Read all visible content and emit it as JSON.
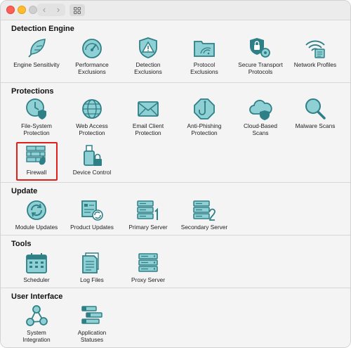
{
  "colors": {
    "icon_stroke": "#2f7f87",
    "icon_fill": "#8fd0d4",
    "highlight": "#e0201b"
  },
  "titlebar": {
    "nav_back_glyph": "‹",
    "nav_forward_glyph": "›"
  },
  "sections": {
    "detection": {
      "title": "Detection Engine",
      "items": [
        "Engine Sensitivity",
        "Performance\nExclusions",
        "Detection\nExclusions",
        "Protocol\nExclusions",
        "Secure Transport\nProtocols",
        "Network Profiles"
      ]
    },
    "protections": {
      "title": "Protections",
      "items": [
        "File-System\nProtection",
        "Web Access\nProtection",
        "Email Client\nProtection",
        "Anti-Phishing\nProtection",
        "Cloud-Based\nScans",
        "Malware Scans",
        "Firewall",
        "Device Control"
      ]
    },
    "update": {
      "title": "Update",
      "items": [
        "Module Updates",
        "Product Updates",
        "Primary Server",
        "Secondary Server"
      ]
    },
    "tools": {
      "title": "Tools",
      "items": [
        "Scheduler",
        "Log Files",
        "Proxy Server"
      ]
    },
    "ui": {
      "title": "User Interface",
      "items": [
        "System\nIntegration",
        "Application\nStatuses"
      ]
    }
  },
  "icons": {
    "detection": [
      "feather-icon",
      "gauge-icon",
      "warning-shield-icon",
      "folder-network-icon",
      "lock-shield-gear-icon",
      "wifi-list-icon"
    ],
    "protections": [
      "clock-shield-icon",
      "globe-icon",
      "envelope-icon",
      "fishhook-icon",
      "cloud-shield-icon",
      "magnifier-icon",
      "firewall-icon",
      "usb-lock-icon"
    ],
    "update": [
      "sync-icon",
      "product-update-icon",
      "server-1-icon",
      "server-2-icon"
    ],
    "tools": [
      "calendar-icon",
      "log-files-icon",
      "proxy-server-icon"
    ],
    "ui": [
      "network-nodes-icon",
      "status-bars-icon"
    ]
  },
  "selected_item": "Firewall"
}
